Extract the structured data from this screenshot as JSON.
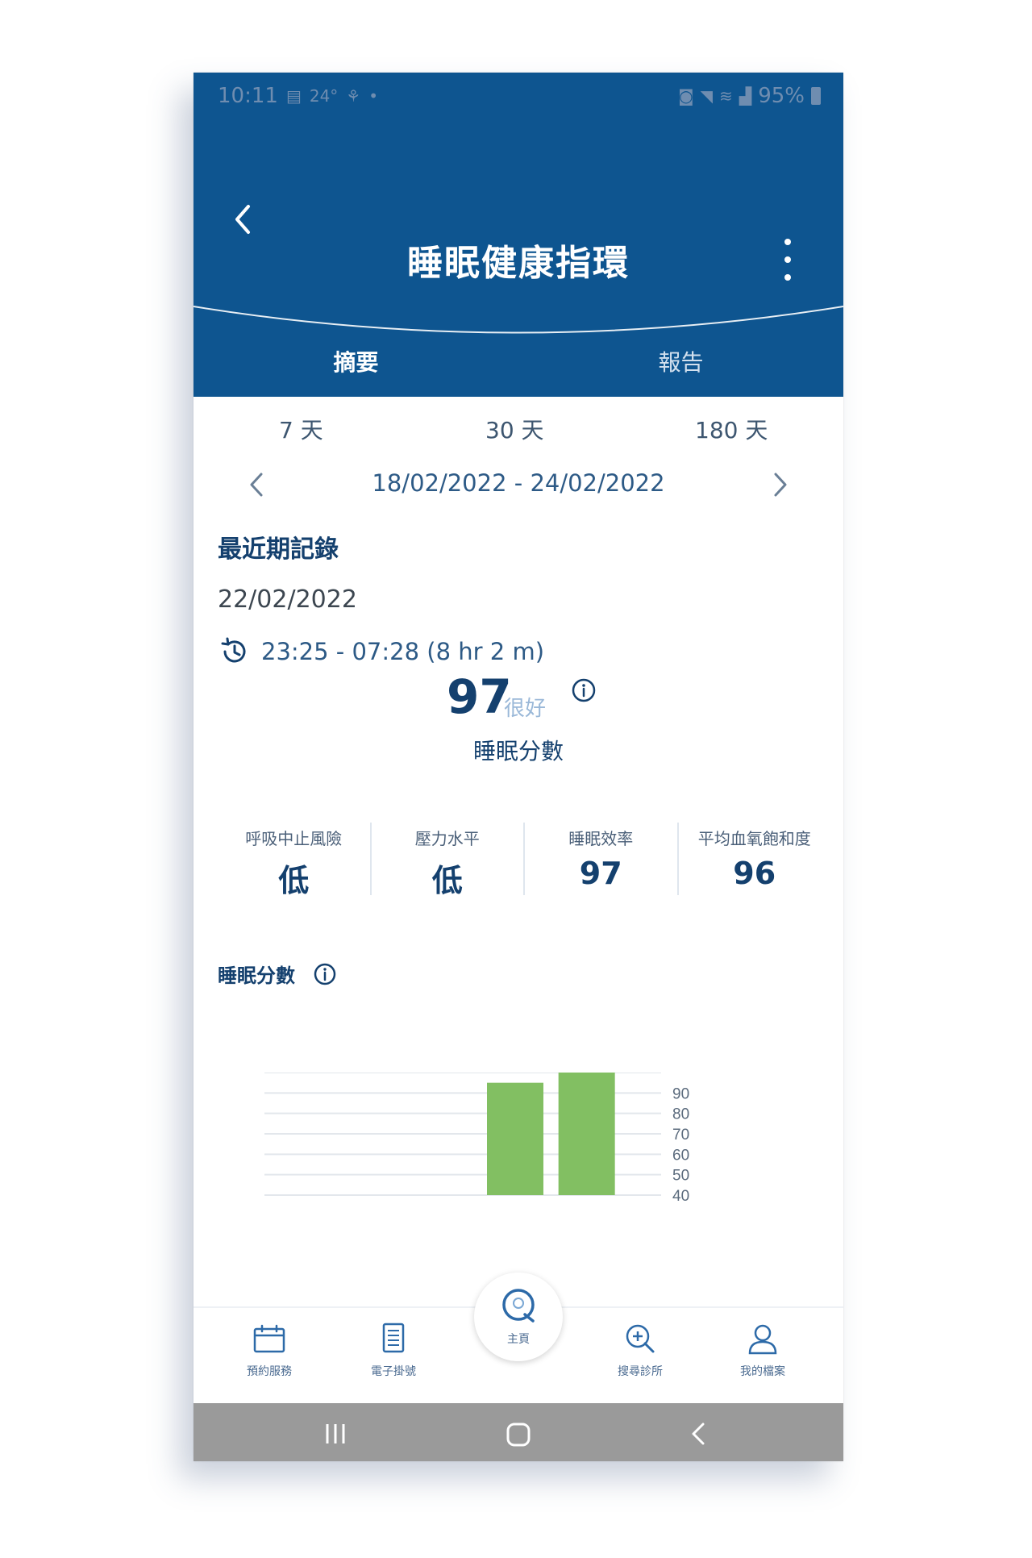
{
  "status_bar": {
    "time": "10:11",
    "weather": "24°",
    "battery": "95%"
  },
  "header": {
    "title": "睡眠健康指環"
  },
  "tabs": [
    {
      "label": "摘要",
      "active": true
    },
    {
      "label": "報告",
      "active": false
    }
  ],
  "ranges": [
    {
      "label": "7 天"
    },
    {
      "label": "30 天"
    },
    {
      "label": "180 天"
    }
  ],
  "date_range": "18/02/2022 - 24/02/2022",
  "recent": {
    "title": "最近期記錄",
    "date": "22/02/2022",
    "time_span": "23:25 - 07:28 (8 hr 2 m)",
    "score": "97",
    "score_label": "很好",
    "score_caption": "睡眠分數"
  },
  "metrics": [
    {
      "label": "呼吸中止風險",
      "value": "低"
    },
    {
      "label": "壓力水平",
      "value": "低"
    },
    {
      "label": "睡眠效率",
      "value": "97"
    },
    {
      "label": "平均血氧飽和度",
      "value": "96"
    }
  ],
  "chart_section": {
    "title": "睡眠分數"
  },
  "chart_data": {
    "type": "bar",
    "title": "睡眠分數",
    "xlabel": "",
    "ylabel": "",
    "y_ticks": [
      "90",
      "80",
      "70",
      "60",
      "50",
      "40"
    ],
    "ylim": [
      40,
      100
    ],
    "values": [
      null,
      null,
      null,
      95,
      100,
      null
    ],
    "bar_color": "#82bf62"
  },
  "bottom_nav": {
    "items": [
      {
        "label": "預約服務",
        "icon": "calendar-icon"
      },
      {
        "label": "電子掛號",
        "icon": "document-icon"
      },
      {
        "label": "搜尋診所",
        "icon": "search-icon"
      },
      {
        "label": "我的檔案",
        "icon": "user-icon"
      }
    ],
    "home_label": "主頁"
  },
  "colors": {
    "header_blue": "#0e5590",
    "dark_text": "#14406e",
    "bar_green": "#82bf62",
    "system_nav": "#9a9a9a"
  }
}
